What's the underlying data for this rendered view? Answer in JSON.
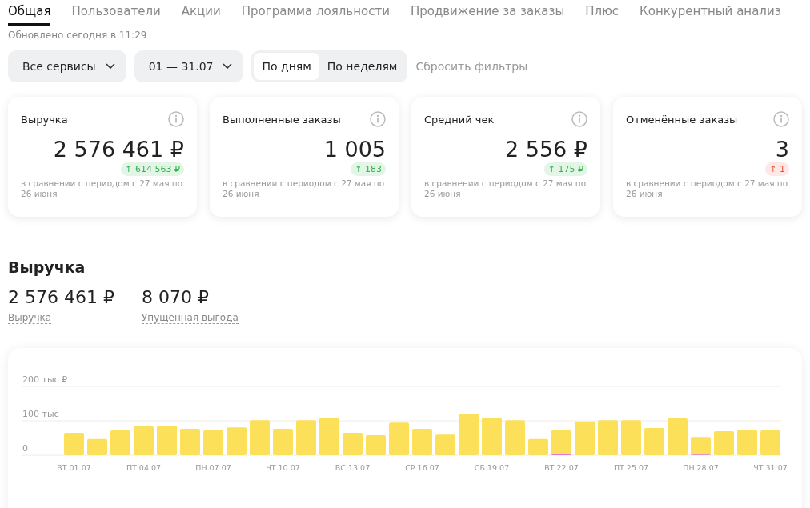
{
  "tabs": [
    {
      "label": "Общая",
      "selected": true
    },
    {
      "label": "Пользователи",
      "selected": false
    },
    {
      "label": "Акции",
      "selected": false
    },
    {
      "label": "Программа лояльности",
      "selected": false
    },
    {
      "label": "Продвижение за заказы",
      "selected": false
    },
    {
      "label": "Плюс",
      "selected": false
    },
    {
      "label": "Конкурентный анализ",
      "selected": false
    }
  ],
  "updated": "Обновлено сегодня в 11:29",
  "filters": {
    "dropdowns": [
      {
        "value": "Все сервисы"
      },
      {
        "value": "01 — 31.07"
      }
    ],
    "granularity": [
      {
        "label": "По дням",
        "selected": true
      },
      {
        "label": "По неделям",
        "selected": false
      }
    ],
    "reset": "Сбросить фильтры"
  },
  "cards": [
    {
      "title": "Выручка",
      "value": "2 576 461 ₽",
      "delta": "↑ 614 563 ₽",
      "color": "#2fb54a",
      "note": "в сравнении с периодом с 27 мая по 26 июня"
    },
    {
      "title": "Выполненные заказы",
      "value": "1 005",
      "delta": "↑ 183",
      "color": "#2fb54a",
      "note": "в сравнении с периодом с 27 мая по 26 июня"
    },
    {
      "title": "Средний чек",
      "value": "2 556 ₽",
      "delta": "↑ 175 ₽",
      "color": "#2fb54a",
      "note": "в сравнении с периодом с 27 мая по 26 июня"
    },
    {
      "title": "Отменённые заказы",
      "value": "3",
      "delta": "↑ 1",
      "color": "#e5533d",
      "note": "в сравнении с периодом с 27 мая по 26 июня"
    }
  ],
  "revenue": {
    "title": "Выручка",
    "totals": [
      {
        "value": "2 576 461 ₽",
        "label": "Выручка"
      },
      {
        "value": "8 070 ₽",
        "label": "Упущенная выгода"
      }
    ],
    "chart_data": {
      "type": "bar",
      "ylim": [
        0,
        200
      ],
      "yticks": [
        {
          "value": 0,
          "label": "0"
        },
        {
          "value": 100,
          "label": "100 тыс"
        },
        {
          "value": 200,
          "label": "200 тыс ₽"
        }
      ],
      "categories": [
        "ВТ 01.07",
        null,
        null,
        "ПТ 04.07",
        null,
        null,
        "ПН 07.07",
        null,
        null,
        "ЧТ 10.07",
        null,
        null,
        "ВС 13.07",
        null,
        null,
        "СР 16.07",
        null,
        null,
        "СБ 19.07",
        null,
        null,
        "ВТ 22.07",
        null,
        null,
        "ПТ 25.07",
        null,
        null,
        "ПН 28.07",
        null,
        null,
        "ЧТ 31.07"
      ],
      "series": [
        {
          "color": "#fde05a",
          "values": [
            65,
            47,
            72,
            84,
            86,
            77,
            72,
            81,
            102,
            77,
            102,
            109,
            65,
            58,
            95,
            77,
            60,
            121,
            109,
            102,
            47,
            74,
            98,
            102,
            102,
            79,
            107,
            53,
            70,
            74,
            72
          ]
        },
        {
          "color": "#e27ad8",
          "values": [
            null,
            null,
            null,
            null,
            null,
            null,
            null,
            null,
            null,
            null,
            null,
            null,
            null,
            null,
            null,
            null,
            null,
            null,
            null,
            null,
            null,
            3,
            null,
            null,
            null,
            null,
            null,
            2,
            null,
            null,
            null
          ]
        }
      ]
    }
  }
}
